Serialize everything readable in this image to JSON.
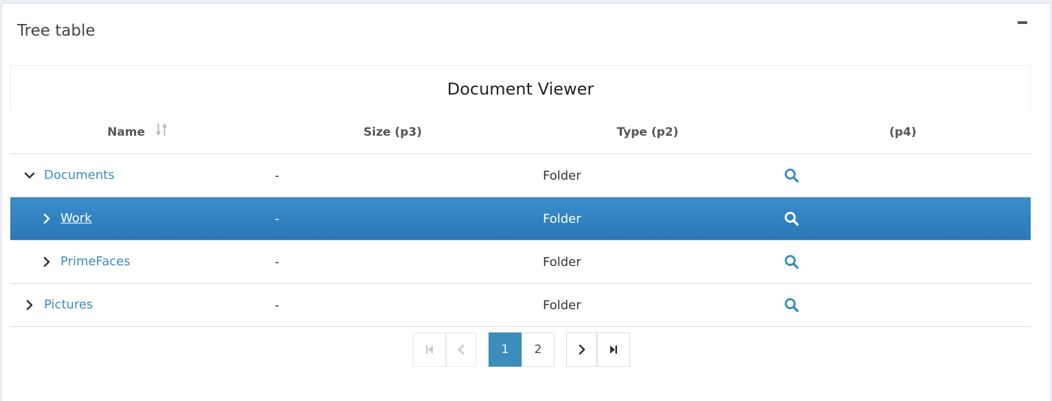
{
  "panel": {
    "title": "Tree table"
  },
  "treetable": {
    "header": "Document Viewer",
    "columns": {
      "name": "Name",
      "size": "Size (p3)",
      "type": "Type (p2)",
      "actions": "(p4)"
    },
    "rows": [
      {
        "name": "Documents",
        "size": "-",
        "type": "Folder",
        "level": 0,
        "expanded": true,
        "selected": false
      },
      {
        "name": "Work",
        "size": "-",
        "type": "Folder",
        "level": 1,
        "expanded": false,
        "selected": true
      },
      {
        "name": "PrimeFaces",
        "size": "-",
        "type": "Folder",
        "level": 1,
        "expanded": false,
        "selected": false
      },
      {
        "name": "Pictures",
        "size": "-",
        "type": "Folder",
        "level": 0,
        "expanded": false,
        "selected": false
      }
    ],
    "icons": {
      "expanded": "chevron-down-icon",
      "collapsed": "chevron-right-icon",
      "action": "search-icon",
      "sort": "sort-icon"
    }
  },
  "paginator": {
    "pages": [
      "1",
      "2"
    ],
    "current_page": "1",
    "icons": {
      "first": "first-page-icon",
      "prev": "prev-page-icon",
      "next": "next-page-icon",
      "last": "last-page-icon"
    }
  },
  "colors": {
    "accent": "#3c8dbc",
    "selected_row": "#2f80c1",
    "text": "#333333"
  }
}
